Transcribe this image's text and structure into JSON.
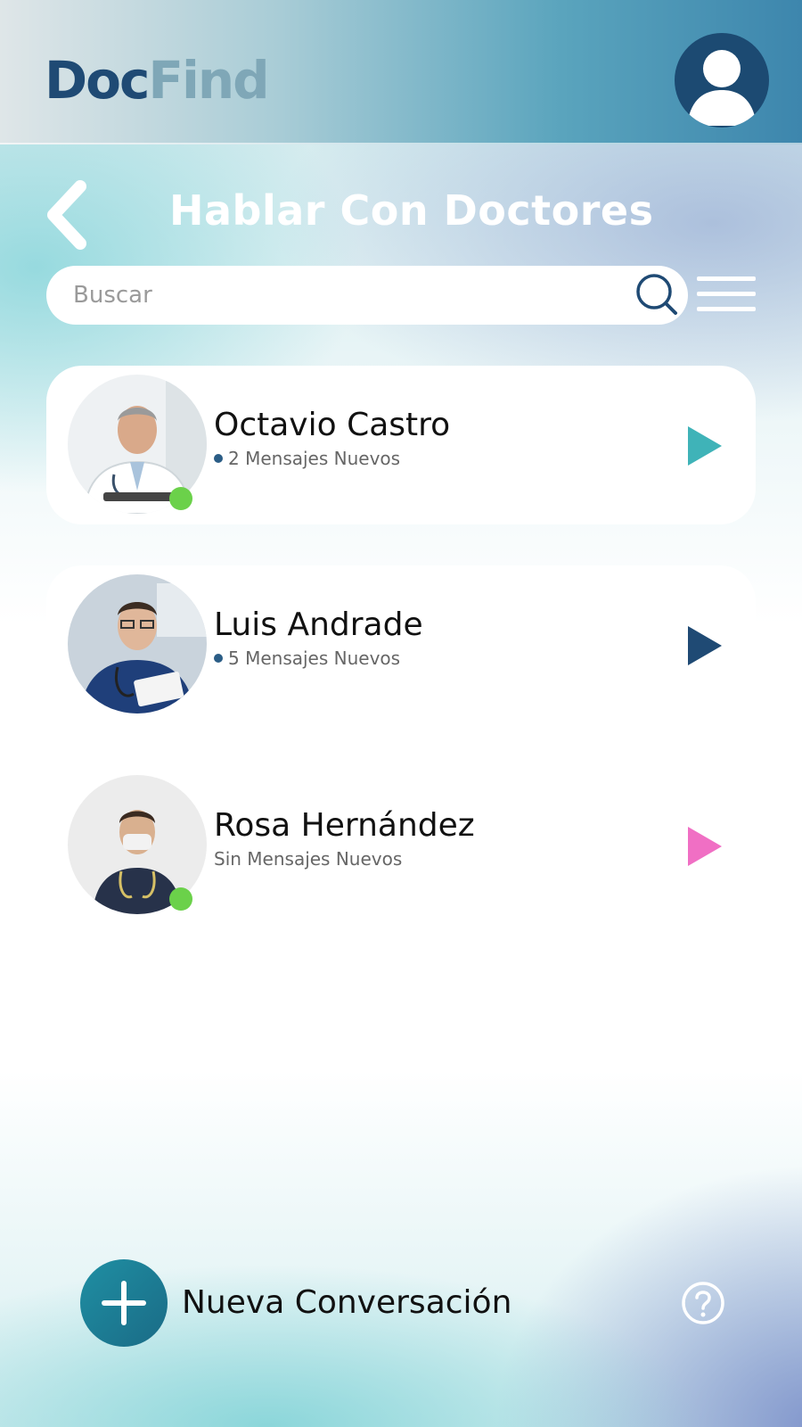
{
  "app": {
    "logo_part1": "Doc",
    "logo_part2": "Find"
  },
  "header": {
    "title": "Hablar Con Doctores"
  },
  "search": {
    "placeholder": "Buscar"
  },
  "doctors": [
    {
      "name": "Octavio Castro",
      "status": "2 Mensajes Nuevos",
      "online": true,
      "arrow_color": "#3fb3b8"
    },
    {
      "name": "Luis Andrade",
      "status": "5 Mensajes Nuevos",
      "online": false,
      "arrow_color": "#1f4a74"
    },
    {
      "name": "Rosa Hernández",
      "status": "Sin Mensajes Nuevos",
      "online": true,
      "arrow_color": "#f06fc4"
    }
  ],
  "footer": {
    "new_conversation_label": "Nueva Conversación"
  },
  "colors": {
    "brand_dark": "#1f4a74",
    "brand_light": "#7fa7b7",
    "online": "#6bd14a",
    "accent_teal": "#1f8fa3"
  }
}
